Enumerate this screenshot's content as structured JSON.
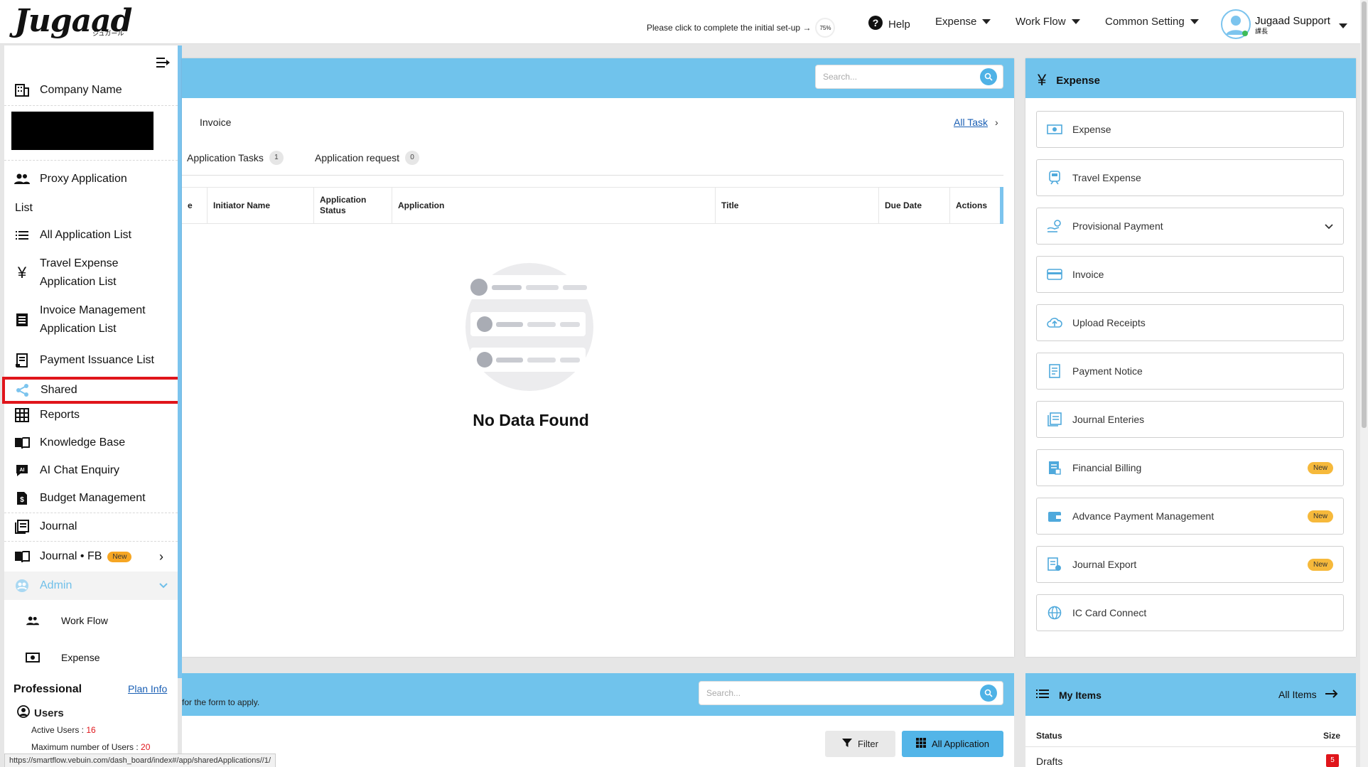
{
  "header": {
    "logo": "Jugaad",
    "logo_sub": "ジュガール",
    "setup_text": "Please click to complete the initial set-up →",
    "setup_pct": "75%",
    "help": "Help",
    "nav": [
      "Expense",
      "Work Flow",
      "Common Setting"
    ],
    "user_name": "Jugaad Support",
    "user_role": "課長"
  },
  "sidebar": {
    "company": "Company Name",
    "proxy": "Proxy Application",
    "list_heading": "List",
    "items": [
      "All Application List",
      "Travel Expense Application List",
      "Invoice Management Application List",
      "Payment Issuance List",
      "Shared",
      "Reports",
      "Knowledge Base",
      "AI Chat Enquiry",
      "Budget Management",
      "Journal",
      "Journal • FB"
    ],
    "new_badge": "New",
    "admin": "Admin",
    "admin_items": [
      "Work Flow",
      "Expense"
    ],
    "plan": "Professional",
    "plan_info": "Plan Info",
    "users": "Users",
    "active_users_label": "Active Users : ",
    "active_users": "16",
    "max_users_label": "Maximum number of Users : ",
    "max_users": "20",
    "highlight_color": "#e0151b"
  },
  "main": {
    "search_placeholder": "Search...",
    "section_label": "Invoice",
    "all_task": "All Task",
    "tabs": [
      {
        "label": "Application Tasks",
        "count": "1"
      },
      {
        "label": "Application request",
        "count": "0"
      }
    ],
    "columns": [
      "e",
      "Initiator Name",
      "Application Status",
      "Application",
      "Title",
      "Due Date",
      "Actions"
    ],
    "empty": "No Data Found"
  },
  "expense_panel": {
    "title": "Expense",
    "tiles": [
      {
        "label": "Expense"
      },
      {
        "label": "Travel Expense"
      },
      {
        "label": "Provisional Payment"
      },
      {
        "label": "Invoice"
      },
      {
        "label": "Upload Receipts"
      },
      {
        "label": "Payment Notice"
      },
      {
        "label": "Journal Enteries"
      },
      {
        "label": "Financial Billing",
        "badge": "New"
      },
      {
        "label": "Advance Payment Management",
        "badge": "New"
      },
      {
        "label": "Journal Export",
        "badge": "New"
      },
      {
        "label": "IC Card Connect"
      }
    ]
  },
  "bottom": {
    "hint": "for the form to apply.",
    "search_placeholder": "Search...",
    "filter": "Filter",
    "all_application": "All Application",
    "my_items": "My Items",
    "all_items": "All Items",
    "status": "Status",
    "size": "Size",
    "drafts": "Drafts",
    "drafts_count": "5"
  },
  "status_url": "https://smartflow.vebuin.com/dash_board/index#/app/sharedApplications//1/"
}
